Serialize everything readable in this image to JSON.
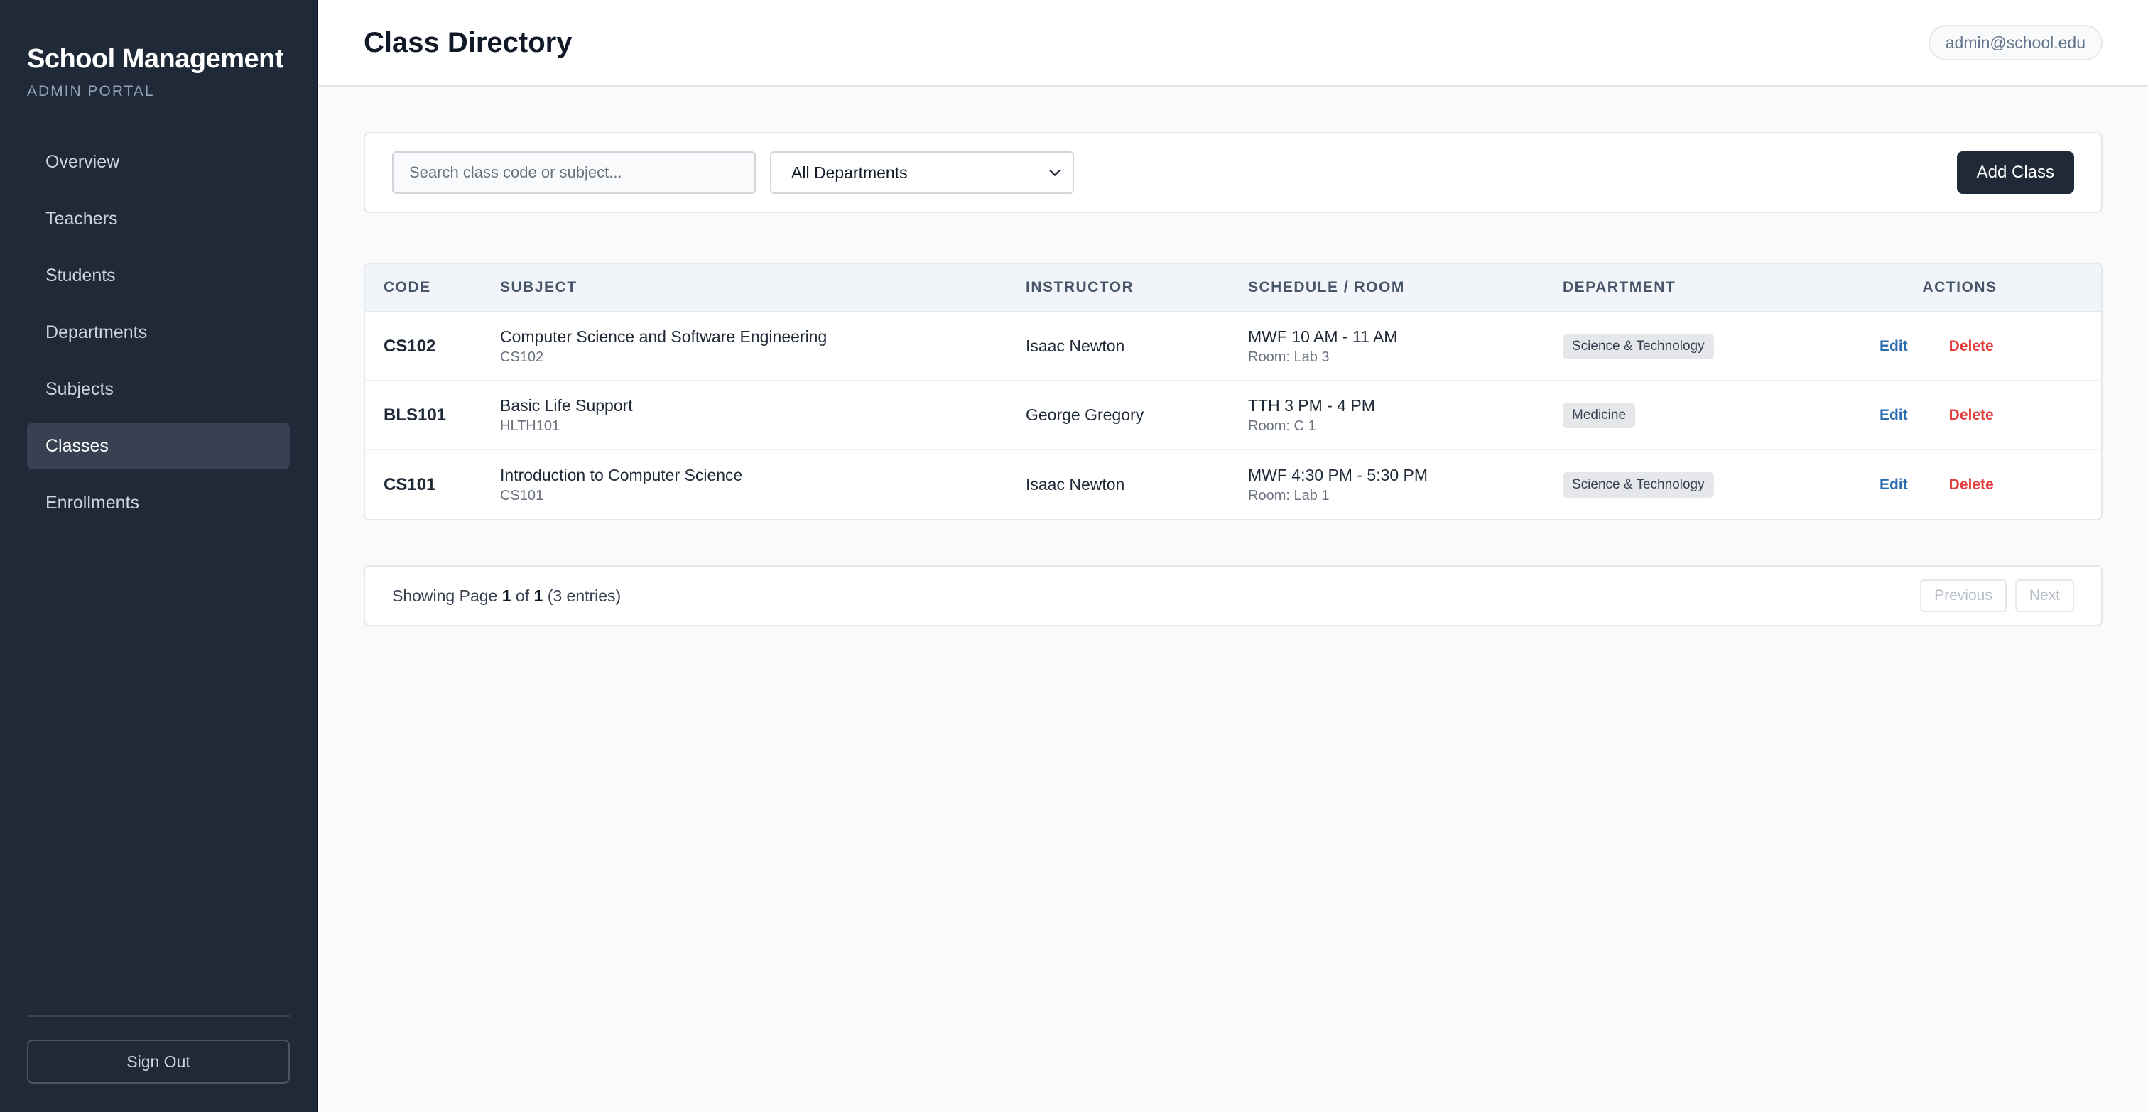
{
  "sidebar": {
    "title": "School Management",
    "subtitle": "ADMIN PORTAL",
    "items": [
      {
        "label": "Overview",
        "active": false
      },
      {
        "label": "Teachers",
        "active": false
      },
      {
        "label": "Students",
        "active": false
      },
      {
        "label": "Departments",
        "active": false
      },
      {
        "label": "Subjects",
        "active": false
      },
      {
        "label": "Classes",
        "active": true
      },
      {
        "label": "Enrollments",
        "active": false
      }
    ],
    "signout_label": "Sign Out"
  },
  "header": {
    "title": "Class Directory",
    "user_email": "admin@school.edu"
  },
  "filters": {
    "search_placeholder": "Search class code or subject...",
    "search_value": "",
    "department_selected": "All Departments",
    "add_label": "Add Class"
  },
  "table": {
    "headers": [
      "CODE",
      "SUBJECT",
      "INSTRUCTOR",
      "SCHEDULE / ROOM",
      "DEPARTMENT",
      "ACTIONS"
    ],
    "rows": [
      {
        "code": "CS102",
        "subject": "Computer Science and Software Engineering",
        "subject_code": "CS102",
        "instructor": "Isaac Newton",
        "schedule": "MWF 10 AM - 11 AM",
        "room": "Room: Lab 3",
        "department": "Science & Technology",
        "edit": "Edit",
        "delete": "Delete"
      },
      {
        "code": "BLS101",
        "subject": "Basic Life Support",
        "subject_code": "HLTH101",
        "instructor": "George Gregory",
        "schedule": "TTH 3 PM - 4 PM",
        "room": "Room: C 1",
        "department": "Medicine",
        "edit": "Edit",
        "delete": "Delete"
      },
      {
        "code": "CS101",
        "subject": "Introduction to Computer Science",
        "subject_code": "CS101",
        "instructor": "Isaac Newton",
        "schedule": "MWF 4:30 PM - 5:30 PM",
        "room": "Room: Lab 1",
        "department": "Science & Technology",
        "edit": "Edit",
        "delete": "Delete"
      }
    ]
  },
  "pagination": {
    "prefix": "Showing Page",
    "current": "1",
    "of": "of",
    "total": "1",
    "entries": "(3 entries)",
    "prev_label": "Previous",
    "next_label": "Next"
  },
  "colors": {
    "sidebar_bg": "#1f2937",
    "primary_button": "#1f2937",
    "edit_link": "#2b6cb0",
    "delete_link": "#e53e3e"
  },
  "icons": {
    "select_arrow": "chevron-down-icon"
  }
}
